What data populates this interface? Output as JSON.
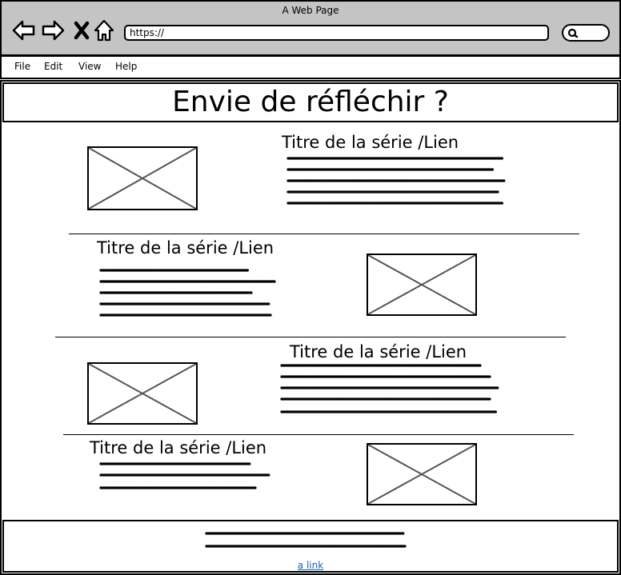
{
  "window": {
    "title": "A Web Page"
  },
  "address_bar": {
    "value": "https://"
  },
  "menu": {
    "items": [
      "File",
      "Edit",
      "View",
      "Help"
    ]
  },
  "page": {
    "title": "Envie de réfléchir ?"
  },
  "series": [
    {
      "title": "Titre de la série /Lien"
    },
    {
      "title": "Titre de la série /Lien"
    },
    {
      "title": "Titre de la série /Lien"
    },
    {
      "title": "Titre de la série /Lien"
    }
  ],
  "footer": {
    "link_label": "a link"
  },
  "icons": [
    "back-arrow-icon",
    "forward-arrow-icon",
    "stop-x-icon",
    "home-icon",
    "search-icon"
  ]
}
